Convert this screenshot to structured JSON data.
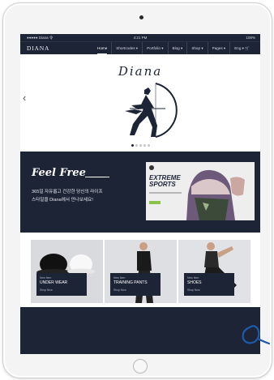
{
  "status_bar": {
    "carrier": "●●●●● Diana 令",
    "time": "4:21 PM",
    "battery": "100%"
  },
  "nav": {
    "brand": "DIANA",
    "items": [
      {
        "label": "Home",
        "active": true
      },
      {
        "label": "Shortcodes ▾",
        "active": false
      },
      {
        "label": "Portfolio ▾",
        "active": false
      },
      {
        "label": "Blog ▾",
        "active": false
      },
      {
        "label": "Shop ▾",
        "active": false
      },
      {
        "label": "Pages ▾",
        "active": false
      },
      {
        "label": "Eng ▾ 🛒",
        "active": false
      }
    ]
  },
  "hero": {
    "title": "Diana",
    "arrow": "‹",
    "slides": 5,
    "current": 1
  },
  "promo": {
    "heading": "Feel Free",
    "line1": "365일 자유롭고 건강한 당신의 라이프",
    "line2": "스타일을 Diana에서 만나보세요!",
    "ad_title_1": "EXTREME",
    "ad_title_2": "SPORTS"
  },
  "products": [
    {
      "tag": "New Item",
      "name": "UNDER WEAR",
      "shop": "Shop Now"
    },
    {
      "tag": "New Item",
      "name": "TRAINING PANTS",
      "shop": "Shop Now"
    },
    {
      "tag": "New Item",
      "name": "SHOES",
      "shop": "Shop Now"
    }
  ],
  "colors": {
    "navy": "#1d2436",
    "white": "#ffffff",
    "accent_green": "#8bc34a",
    "scribble": "#1f5aa8"
  }
}
